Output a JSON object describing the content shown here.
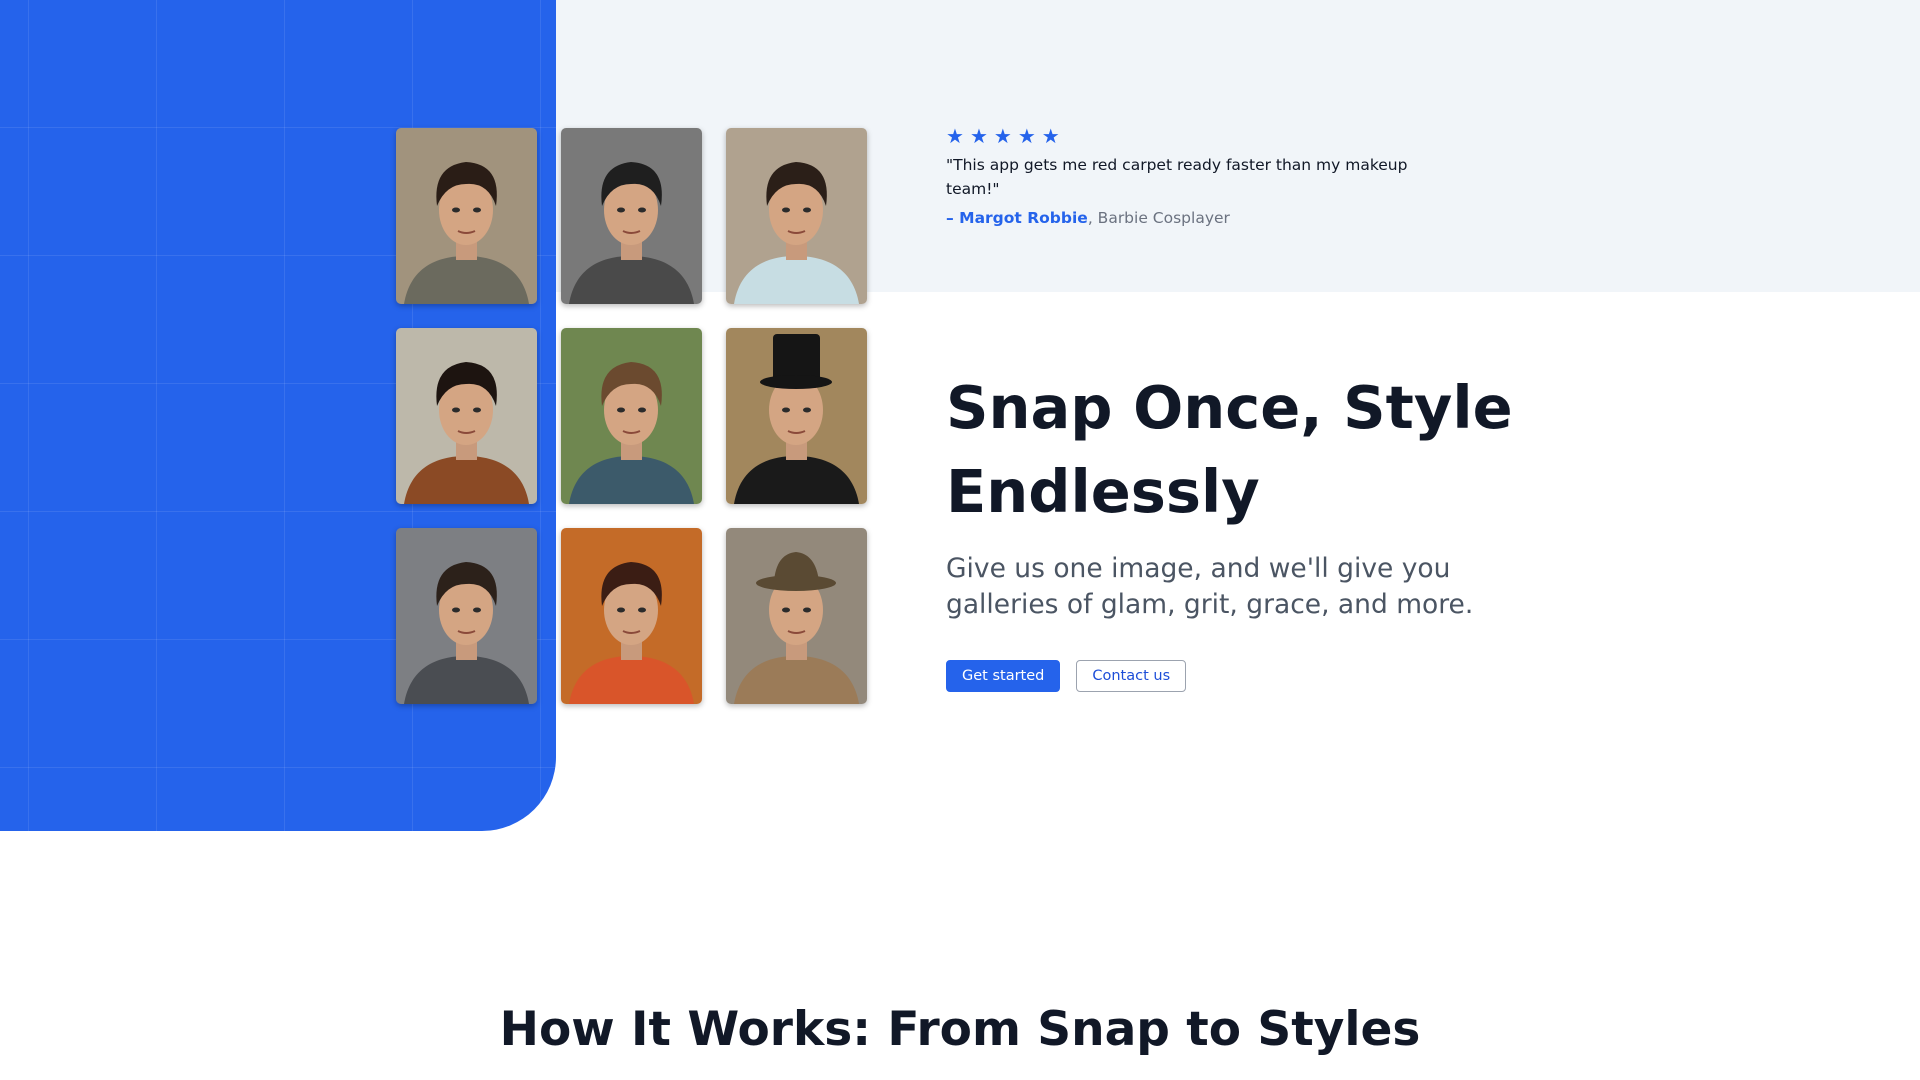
{
  "colors": {
    "accent": "#2563eb",
    "band": "#f1f5f9",
    "heading": "#111827"
  },
  "gallery": {
    "photos": [
      {
        "name": "photo-casual-tshirt",
        "bg": "#b8a88f",
        "outfit": "#6b6a5e",
        "hair": "#2a1d16",
        "hat": ""
      },
      {
        "name": "photo-black-and-white-city",
        "bg": "#8a8a8a",
        "outfit": "#4a4a4a",
        "hair": "#1f1f1f",
        "hat": ""
      },
      {
        "name": "photo-office-shirt",
        "bg": "#c9b9a3",
        "outfit": "#c7dde3",
        "hair": "#2b1f18",
        "hat": ""
      },
      {
        "name": "photo-spiky-hair-scarf",
        "bg": "#d8d2c2",
        "outfit": "#8b4a25",
        "hair": "#1d1410",
        "hat": ""
      },
      {
        "name": "photo-mountain-jacket",
        "bg": "#7f9a5c",
        "outfit": "#3c5a6a",
        "hair": "#6b4a2f",
        "hat": ""
      },
      {
        "name": "photo-top-hat",
        "bg": "#b99a6a",
        "outfit": "#1a1a1a",
        "hair": "#2a1f18",
        "hat": "top"
      },
      {
        "name": "photo-grey-suit",
        "bg": "#8f9196",
        "outfit": "#4a4d52",
        "hair": "#2c211a",
        "hat": ""
      },
      {
        "name": "photo-psychedelic-shirt",
        "bg": "#e07a2e",
        "outfit": "#d9552a",
        "hair": "#3b1d14",
        "hat": ""
      },
      {
        "name": "photo-fedora-trenchcoat",
        "bg": "#a89c8c",
        "outfit": "#9b7b58",
        "hair": "#2b2019",
        "hat": "fedora"
      }
    ]
  },
  "testimonial": {
    "stars": [
      "★",
      "★",
      "★",
      "★",
      "★"
    ],
    "quote": "\"This app gets me red carpet ready faster than my makeup team!\"",
    "author": "– Margot Robbie",
    "role": ", Barbie Cosplayer"
  },
  "hero": {
    "title": "Snap Once, Style Endlessly",
    "subtitle": "Give us one image, and we'll give you galleries of glam, grit, grace, and more.",
    "primary_button": "Get started",
    "secondary_button": "Contact us"
  },
  "how_it_works": {
    "title": "How It Works: From Snap to Styles"
  }
}
